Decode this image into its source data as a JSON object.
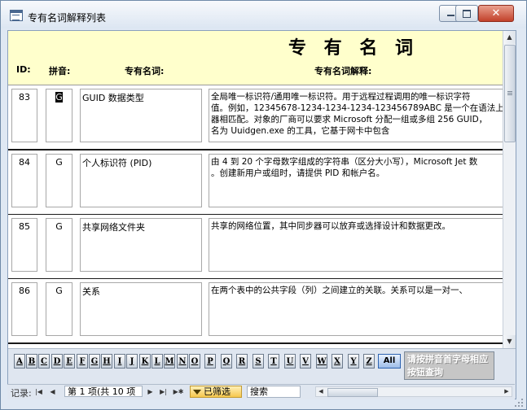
{
  "window": {
    "title": "专有名词解释列表",
    "close_glyph": "✕"
  },
  "header": {
    "title": "专 有 名 词",
    "labels": {
      "id": "ID:",
      "pinyin": "拼音:",
      "term": "专有名词:",
      "desc": "专有名词解释:"
    }
  },
  "records": [
    {
      "id": "83",
      "pinyin": "G",
      "term": "GUID 数据类型",
      "desc": [
        "全局唯一标识符/通用唯一标识符。用于远程过程调用的唯一标识字符",
        "值。例如，12345678-1234-1234-1234-123456789ABC 是一个在语法上",
        "器相匹配。对象的厂商可以要求 Microsoft 分配一组或多组 256 GUID，",
        "名为 Uuidgen.exe 的工具，它基于网卡中包含"
      ]
    },
    {
      "id": "84",
      "pinyin": "G",
      "term": "个人标识符 (PID)",
      "desc": [
        "由 4 到 20 个字母数字组成的字符串（区分大小写），Microsoft Jet 数",
        "。创建新用户或组时，请提供 PID 和帐户名。"
      ]
    },
    {
      "id": "85",
      "pinyin": "G",
      "term": "共享网络文件夹",
      "desc": [
        "共享的网络位置，其中同步器可以放弃或选择设计和数据更改。"
      ]
    },
    {
      "id": "86",
      "pinyin": "G",
      "term": "关系",
      "desc": [
        "在两个表中的公共字段（列）之间建立的关联。关系可以是一对一、"
      ]
    }
  ],
  "letter_buttons": [
    "A",
    "B",
    "C",
    "D",
    "E",
    "F",
    "G",
    "H",
    "I",
    "J",
    "K",
    "L",
    "M",
    "N",
    "O",
    "P",
    "Q",
    "R",
    "S",
    "T",
    "U",
    "V",
    "W",
    "X",
    "Y",
    "Z"
  ],
  "all_button": "All",
  "hint_text": "请按拼音首字母相应按钮查询",
  "nav": {
    "label": "记录:",
    "first": "|◀",
    "prev": "◀",
    "next": "▶",
    "last": "▶|",
    "new": "▶✱",
    "position": "第 1 项(共 10 项",
    "filter": "已筛选",
    "search": "搜索"
  },
  "colors": {
    "header_bg": "#ffffcc",
    "footer_bg": "#dfe6f0",
    "filter_bg": "#f6c74d",
    "all_button": "#9ebde8"
  }
}
